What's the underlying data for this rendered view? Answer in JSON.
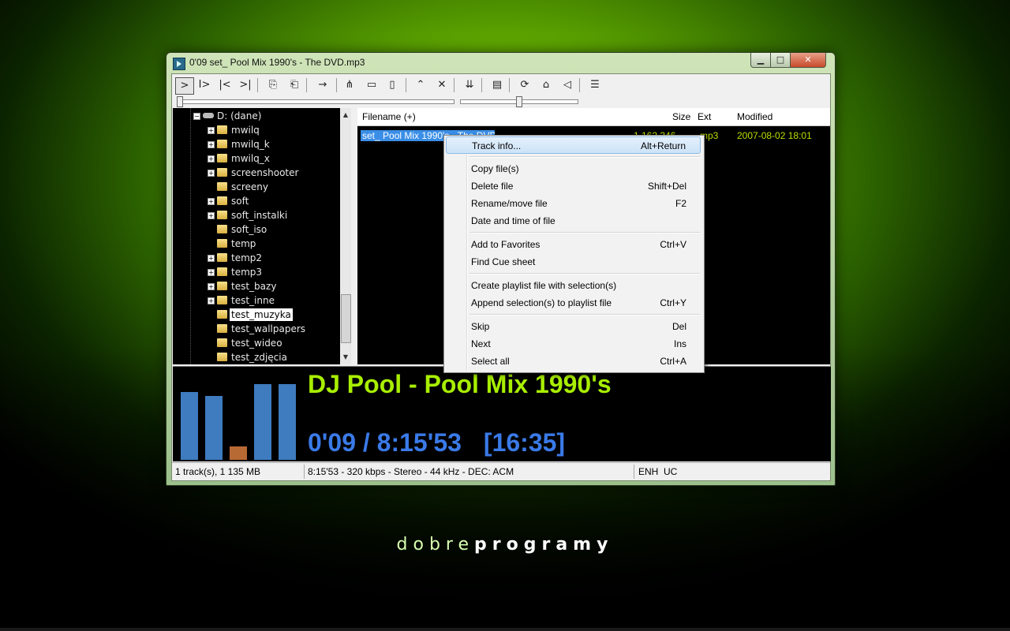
{
  "window": {
    "title": "0'09 set_ Pool Mix 1990's - The DVD.mp3",
    "min_glyph": "▁",
    "max_glyph": "□",
    "close_glyph": "✕"
  },
  "toolbar": {
    "buttons": [
      "play",
      "play-pause",
      "previous",
      "next",
      "open-folder",
      "open-file",
      "jump",
      "playlist",
      "view-a",
      "view-b",
      "view-c",
      "up",
      "delete",
      "sort",
      "split",
      "refresh",
      "home",
      "volume",
      "settings"
    ],
    "glyphs": {
      "play": ">",
      "play_pause": "I>",
      "previous": "|<",
      "next": ">|",
      "open_folder": "⎘",
      "open_file": "⎗",
      "jump": "→",
      "tool1": "⋔",
      "tool2": "▭",
      "tool3": "▯",
      "up": "⌃",
      "close": "✕",
      "down": "⇊",
      "split": "▤",
      "refresh": "⟳",
      "home": "⌂",
      "volume": "◁",
      "settings": "☰"
    }
  },
  "sliders": {
    "position_fraction": 0.0,
    "volume_fraction": 0.5
  },
  "tree": {
    "drive": "D: (dane)",
    "folders": [
      {
        "label": "mwilq",
        "expandable": true
      },
      {
        "label": "mwilq_k",
        "expandable": true
      },
      {
        "label": "mwilq_x",
        "expandable": true
      },
      {
        "label": "screenshooter",
        "expandable": true
      },
      {
        "label": "screeny",
        "expandable": false
      },
      {
        "label": "soft",
        "expandable": true
      },
      {
        "label": "soft_instalki",
        "expandable": true
      },
      {
        "label": "soft_iso",
        "expandable": false
      },
      {
        "label": "temp",
        "expandable": false
      },
      {
        "label": "temp2",
        "expandable": true
      },
      {
        "label": "temp3",
        "expandable": true
      },
      {
        "label": "test_bazy",
        "expandable": true
      },
      {
        "label": "test_inne",
        "expandable": true
      },
      {
        "label": "test_muzyka",
        "expandable": false,
        "selected": true
      },
      {
        "label": "test_wallpapers",
        "expandable": false
      },
      {
        "label": "test_wideo",
        "expandable": false
      },
      {
        "label": "test_zdjęcia",
        "expandable": false
      }
    ]
  },
  "files": {
    "columns": {
      "filename": "Filename (+)",
      "size": "Size",
      "ext": "Ext",
      "modified": "Modified"
    },
    "rows": [
      {
        "filename": "set_ Pool Mix 1990's - The DVD",
        "size": "1 162 346",
        "ext": "mp3",
        "modified": "2007-08-02 18:01"
      }
    ]
  },
  "context_menu": {
    "items": [
      {
        "label": "Track info...",
        "shortcut": "Alt+Return",
        "highlighted": true
      },
      {
        "label": "Copy file(s)",
        "shortcut": ""
      },
      {
        "label": "Delete file",
        "shortcut": "Shift+Del"
      },
      {
        "label": "Rename/move file",
        "shortcut": "F2"
      },
      {
        "label": "Date and time of file",
        "shortcut": ""
      },
      {
        "label": "Add to Favorites",
        "shortcut": "Ctrl+V"
      },
      {
        "label": "Find Cue sheet",
        "shortcut": ""
      },
      {
        "label": "Create playlist file with selection(s)",
        "shortcut": ""
      },
      {
        "label": "Append selection(s) to playlist file",
        "shortcut": "Ctrl+Y"
      },
      {
        "label": "Skip",
        "shortcut": "Del"
      },
      {
        "label": "Next",
        "shortcut": "Ins"
      },
      {
        "label": "Select all",
        "shortcut": "Ctrl+A"
      }
    ]
  },
  "player": {
    "track_title": "DJ Pool - Pool Mix 1990's",
    "elapsed_total": "0'09 / 8:15'53",
    "remaining": "[16:35]",
    "spectrum": [
      {
        "level": 0.78,
        "color": "#3e7bbf"
      },
      {
        "level": 0.74,
        "color": "#3e7bbf"
      },
      {
        "level": 0.15,
        "color": "#b86a35"
      },
      {
        "level": 0.87,
        "color": "#3e7bbf"
      },
      {
        "level": 0.87,
        "color": "#3e7bbf"
      }
    ]
  },
  "status": {
    "tracks": "1 track(s), 1 135 MB",
    "info": "8:15'53 - 320 kbps - Stereo - 44 kHz - DEC: ACM",
    "lang": "ENH  UC"
  },
  "brand": {
    "light": "dobre",
    "bold": "programy"
  },
  "colors": {
    "accent_green": "#a8ee00",
    "time_blue": "#3a7ae8",
    "selection_blue": "#3a8ee6"
  }
}
